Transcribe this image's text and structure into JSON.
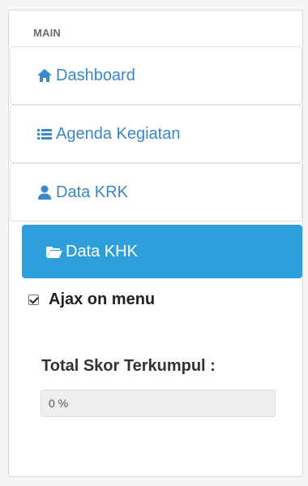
{
  "sidebar": {
    "section_title": "MAIN",
    "items": [
      {
        "label": "Dashboard",
        "icon": "home-icon"
      },
      {
        "label": "Agenda Kegiatan",
        "icon": "list-icon"
      },
      {
        "label": "Data KRK",
        "icon": "user-icon"
      },
      {
        "label": "Data KHK",
        "icon": "folder-open-icon",
        "active": true
      }
    ]
  },
  "ajax": {
    "label": "Ajax on menu",
    "checked": true
  },
  "score": {
    "label": "Total Skor Terkumpul :",
    "value": "0 %"
  },
  "colors": {
    "link": "#3a87c9",
    "active_bg": "#2f9fdc"
  }
}
